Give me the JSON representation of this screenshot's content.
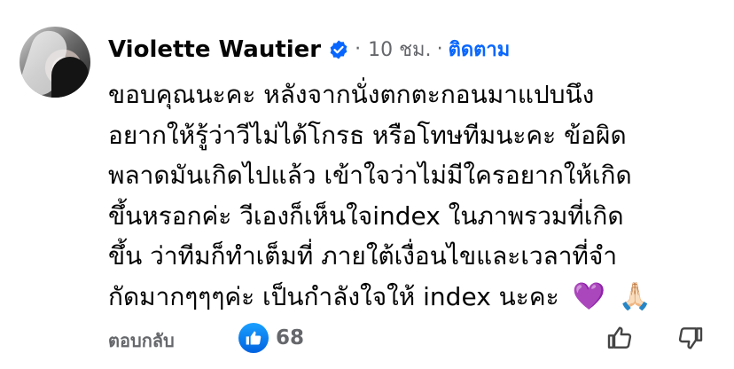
{
  "comment": {
    "author": "Violette Wautier",
    "time": "10 ชม.",
    "separator": "·",
    "separator2": "·",
    "follow_label": "ติดตาม",
    "lines": [
      "ขอบคุณนะคะ หลังจากนั่งตกตะกอนมาแปบนึง",
      "อยากให้รู้ว่าวีไม่ได้โกรธ หรือโทษทีมนะคะ ข้อผิด",
      "พลาดมันเกิดไปแล้ว เข้าใจว่าไม่มีใครอยากให้เกิด",
      "ขึ้นหรอกค่ะ วีเองก็เห็นใจindex ในภาพรวมที่เกิด",
      "ขึ้น ว่าทีมก็ทำเต็มที่ ภายใต้เงื่อนไขและเวลาที่จำ",
      "กัดมากๆๆๆค่ะ เป็นกำลังใจให้ index นะคะ"
    ],
    "emoji_heart": "💜",
    "emoji_hands": "🙏🏻"
  },
  "footer": {
    "reply_label": "ตอบกลับ",
    "like_count": "68"
  },
  "icons": {
    "verified": "verified-badge-icon",
    "like": "thumbs-up-filled-icon",
    "like_action": "thumbs-up-outline-icon",
    "dislike_action": "thumbs-down-outline-icon"
  },
  "colors": {
    "accent": "#0866ff",
    "muted": "#65676b",
    "text": "#050505"
  }
}
